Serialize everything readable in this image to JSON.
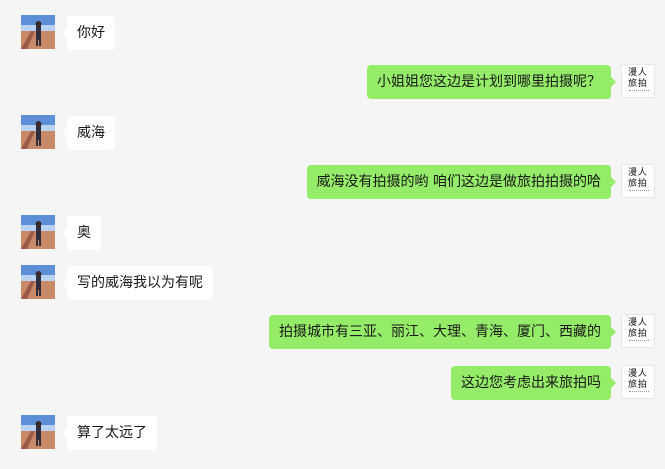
{
  "messages": [
    {
      "side": "in",
      "text": "你好"
    },
    {
      "side": "out",
      "text": "小姐姐您这边是计划到哪里拍摄呢？"
    },
    {
      "side": "in",
      "text": "威海"
    },
    {
      "side": "out",
      "text": "威海没有拍摄的哟  咱们这边是做旅拍拍摄的哈"
    },
    {
      "side": "in",
      "text": "奥"
    },
    {
      "side": "in",
      "text": "写的威海我以为有呢"
    },
    {
      "side": "out",
      "text": "拍摄城市有三亚、丽江、大理、青海、厦门、西藏的"
    },
    {
      "side": "out",
      "text": "这边您考虑出来旅拍吗"
    },
    {
      "side": "in",
      "text": "算了太远了"
    }
  ],
  "agent_avatar": {
    "logo_text": "漫 人 旅 拍",
    "icon": "brand-logo-icon"
  },
  "user_avatar": {
    "icon": "user-photo-avatar"
  },
  "colors": {
    "outgoing_bubble": "#95ec69",
    "incoming_bubble": "#ffffff",
    "background": "#f5f5f5"
  }
}
